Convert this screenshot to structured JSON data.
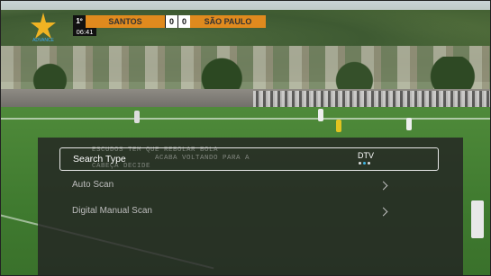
{
  "scoreboard": {
    "period": "1º",
    "clock": "06:41",
    "home_team": "SANTOS",
    "home_score": "0",
    "away_score": "0",
    "away_team": "SÃO PAULO",
    "bar_color": "#e08a1e"
  },
  "ticker_text": [
    "ESCUDOS TEM QUE REBOLAR BOLA",
    "ACABA VOLTANDO PARA A",
    "CABEÇA DECIDE"
  ],
  "menu": {
    "items": [
      {
        "label": "Search Type",
        "value": "DTV",
        "selected": true,
        "icon": "page-dots",
        "pages": 3,
        "active_page": 2
      },
      {
        "label": "Auto Scan",
        "icon": "chevron-right-icon"
      },
      {
        "label": "Digital Manual Scan",
        "icon": "chevron-right-icon"
      }
    ],
    "highlight_color": "#3fb6e6"
  }
}
